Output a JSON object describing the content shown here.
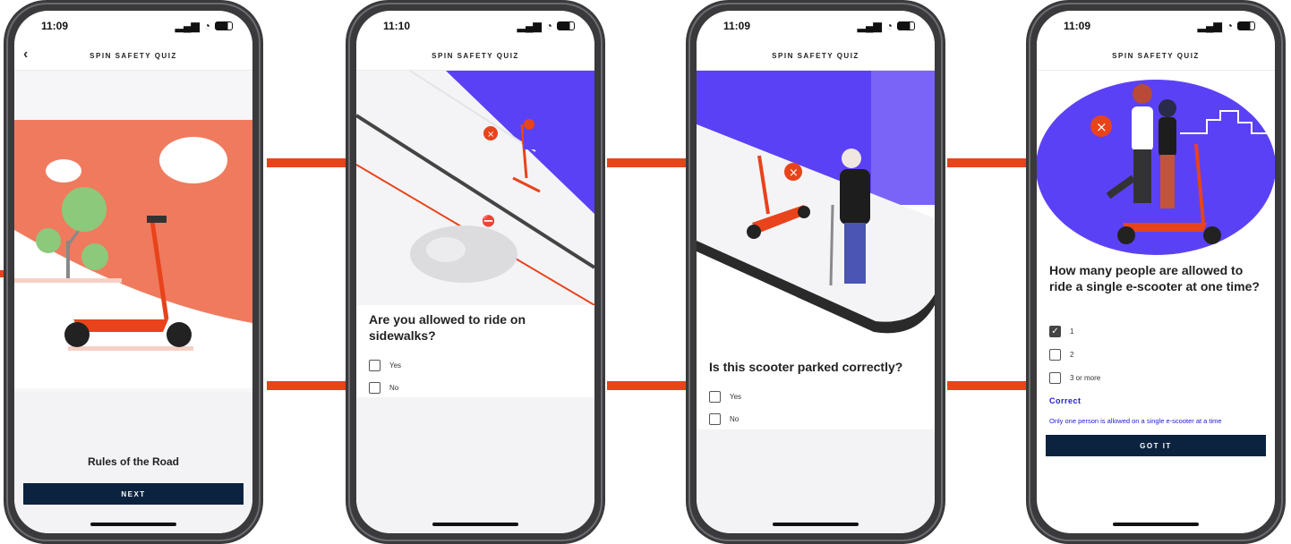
{
  "colors": {
    "brand_orange": "#e8431b",
    "illus_orange": "#f07a5e",
    "purple": "#5b41f5",
    "navy": "#0c2340",
    "link_blue": "#1b1bcf"
  },
  "screens": [
    {
      "time": "11:09",
      "app_title": "SPIN SAFETY QUIZ",
      "back_icon": "chevron-left-icon",
      "title": "Rules of the Road",
      "button": "NEXT"
    },
    {
      "time": "11:10",
      "app_title": "SPIN SAFETY QUIZ",
      "question": "Are you allowed to ride on sidewalks?",
      "options": [
        "Yes",
        "No"
      ]
    },
    {
      "time": "11:09",
      "app_title": "SPIN SAFETY QUIZ",
      "question": "Is this scooter parked correctly?",
      "options": [
        "Yes",
        "No"
      ]
    },
    {
      "time": "11:09",
      "app_title": "SPIN SAFETY QUIZ",
      "question": "How many people are allowed to ride a single e-scooter at one time?",
      "options": [
        "1",
        "2",
        "3 or more"
      ],
      "selected_option": "1",
      "feedback_title": "Correct",
      "feedback_text": "Only one person is allowed on a single e-scooter at a time",
      "button": "GOT IT"
    }
  ]
}
